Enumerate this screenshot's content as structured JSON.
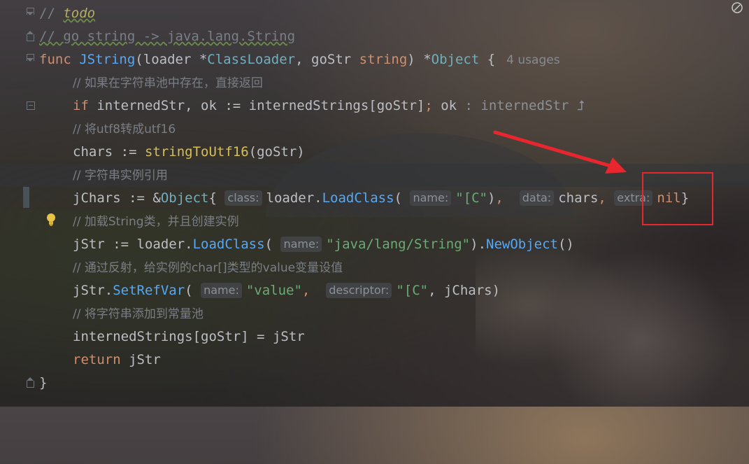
{
  "editor": {
    "lines": [
      {
        "id": "l1"
      },
      {
        "id": "l2"
      }
    ],
    "comment_todo_prefix": "// ",
    "comment_todo": "todo",
    "comment_convert": "// go string -> java.lang.String",
    "func_kw": "func",
    "func_name": "JString",
    "param_open": "(",
    "param_loader": "loader ",
    "ptr1": "*",
    "type_classloader": "ClassLoader",
    "comma1": ", ",
    "param_gostr": "goStr ",
    "type_string": "string",
    "param_close": ") ",
    "ptr2": "*",
    "type_object": "Object",
    "brace_open": " {",
    "usages": "4 usages",
    "c1": "// 如果在字符串池中存在，直接返回",
    "if_kw": "if",
    "if_body": " internedStr, ok := internedStrings[goStr]",
    "if_semi": ";",
    "if_ok": " ok",
    "if_hint": " : internedStr ",
    "if_hint_arrow": "⮥",
    "c2": "// 将utf8转成utf16",
    "chars_lhs": "chars := ",
    "chars_fn": "stringToUtf16",
    "chars_args": "(goStr)",
    "c3": "// 字符串实例引用",
    "jchars_lhs": "jChars := &",
    "jchars_type": "Object",
    "jchars_brace": "{",
    "hint_class": "class:",
    "jchars_loader": "loader.",
    "jchars_loadclass": "LoadClass",
    "jchars_paren": "(",
    "hint_name": "name:",
    "jchars_str": "\"[C\"",
    "jchars_close": ")",
    "jchars_comma": ", ",
    "hint_data": "data:",
    "jchars_chars": "chars",
    "jchars_comma2": ", ",
    "hint_extra": "extra:",
    "jchars_nil": "nil",
    "jchars_end": "}",
    "c4": "// 加载String类，并且创建实例",
    "jstr_lhs": "jStr := loader.",
    "jstr_loadclass": "LoadClass",
    "jstr_paren": "(",
    "hint_name2": "name:",
    "jstr_str": "\"java/lang/String\"",
    "jstr_close": ").",
    "jstr_newobj": "NewObject",
    "jstr_end": "()",
    "c5": "// 通过反射，给实例的char[]类型的value变量设值",
    "set_lhs": "jStr.",
    "set_fn": "SetRefVar",
    "set_paren": "(",
    "hint_name3": "name:",
    "set_str1": "\"value\"",
    "set_comma": ", ",
    "hint_descriptor": "descriptor:",
    "set_str2": "\"[C\"",
    "set_rest": ", jChars)",
    "c6": "// 将字符串添加到常量池",
    "interned_assign": "internedStrings[goStr] = jStr",
    "return_kw": "return",
    "return_val": " jStr",
    "close_brace": "}"
  },
  "colors": {
    "keyword": "#cf8e6d",
    "function": "#56a8f5",
    "string": "#6aab73",
    "comment": "#7a7e85",
    "annotation_red": "#e8262e"
  },
  "icons": {
    "gutter_bulb": "lightbulb-icon",
    "fold": "fold-icon",
    "corner": "notification-icon"
  }
}
